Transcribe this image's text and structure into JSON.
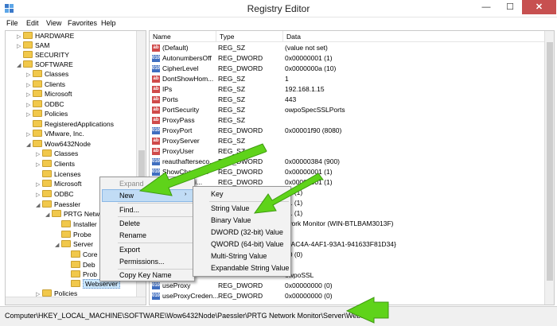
{
  "window": {
    "title": "Registry Editor",
    "minimize": "—",
    "maximize": "☐",
    "close": "✕"
  },
  "menubar": [
    "File",
    "Edit",
    "View",
    "Favorites",
    "Help"
  ],
  "tree": [
    {
      "label": "HARDWARE"
    },
    {
      "label": "SAM"
    },
    {
      "label": "SECURITY"
    },
    {
      "label": "SOFTWARE"
    },
    {
      "label": "Classes"
    },
    {
      "label": "Clients"
    },
    {
      "label": "Microsoft"
    },
    {
      "label": "ODBC"
    },
    {
      "label": "Policies"
    },
    {
      "label": "RegisteredApplications"
    },
    {
      "label": "VMware, Inc."
    },
    {
      "label": "Wow6432Node"
    },
    {
      "label": "Classes"
    },
    {
      "label": "Clients"
    },
    {
      "label": "Licenses"
    },
    {
      "label": "Microsoft"
    },
    {
      "label": "ODBC"
    },
    {
      "label": "Paessler"
    },
    {
      "label": "PRTG Netw"
    },
    {
      "label": "Installer"
    },
    {
      "label": "Probe"
    },
    {
      "label": "Server"
    },
    {
      "label": "Core"
    },
    {
      "label": "Deb"
    },
    {
      "label": "Prob"
    },
    {
      "label": "Webserver"
    },
    {
      "label": "Policies"
    }
  ],
  "list": {
    "columns": [
      "Name",
      "Type",
      "Data"
    ],
    "rows": [
      {
        "icon": "ab",
        "name": "(Default)",
        "type": "REG_SZ",
        "data": "(value not set)"
      },
      {
        "icon": "010",
        "name": "AutonumbersOff",
        "type": "REG_DWORD",
        "data": "0x00000001 (1)"
      },
      {
        "icon": "010",
        "name": "CipherLevel",
        "type": "REG_DWORD",
        "data": "0x0000000a (10)"
      },
      {
        "icon": "ab",
        "name": "DontShowHom...",
        "type": "REG_SZ",
        "data": "1"
      },
      {
        "icon": "ab",
        "name": "IPs",
        "type": "REG_SZ",
        "data": "192.168.1.15"
      },
      {
        "icon": "ab",
        "name": "Ports",
        "type": "REG_SZ",
        "data": "443"
      },
      {
        "icon": "ab",
        "name": "PortSecurity",
        "type": "REG_SZ",
        "data": "owpoSpecSSLPorts"
      },
      {
        "icon": "ab",
        "name": "ProxyPass",
        "type": "REG_SZ",
        "data": ""
      },
      {
        "icon": "010",
        "name": "ProxyPort",
        "type": "REG_DWORD",
        "data": "0x00001f90 (8080)"
      },
      {
        "icon": "ab",
        "name": "ProxyServer",
        "type": "REG_SZ",
        "data": ""
      },
      {
        "icon": "ab",
        "name": "ProxyUser",
        "type": "REG_SZ",
        "data": ""
      },
      {
        "icon": "010",
        "name": "reauthafterseco...",
        "type": "REG_DWORD",
        "data": "0x00000384 (900)"
      },
      {
        "icon": "010",
        "name": "ShowChange...",
        "type": "REG_DWORD",
        "data": "0x00000001 (1)"
      },
      {
        "icon": "010",
        "name": "ShowLockli...",
        "type": "REG_DWORD",
        "data": "0x00000001 (1)"
      },
      {
        "icon": "ab",
        "name": "",
        "type": "",
        "data": "01 (1)"
      },
      {
        "icon": "ab",
        "name": "",
        "type": "",
        "data": "01 (1)"
      },
      {
        "icon": "ab",
        "name": "",
        "type": "",
        "data": "01 (1)"
      },
      {
        "icon": "ab",
        "name": "",
        "type": "",
        "data": "twork Monitor (WIN-BTLBAM3013F)"
      },
      {
        "icon": "ab",
        "name": "",
        "type": "",
        "data": ""
      },
      {
        "icon": "ab",
        "name": "",
        "type": "",
        "data": "1-AC4A-4AF1-93A1-941633F81D34}"
      },
      {
        "icon": "ab",
        "name": "",
        "type": "",
        "data": "00 (0)"
      },
      {
        "icon": "ab",
        "name": "",
        "type": "",
        "data": "s"
      },
      {
        "icon": "ab",
        "name": "",
        "type": "",
        "data": "owpoSSL"
      },
      {
        "icon": "010",
        "name": "useProxy",
        "type": "REG_DWORD",
        "data": "0x00000000 (0)"
      },
      {
        "icon": "010",
        "name": "useProxyCreden...",
        "type": "REG_DWORD",
        "data": "0x00000000 (0)"
      }
    ]
  },
  "context_menu": {
    "items": [
      "Expand",
      "New",
      "Find...",
      "Delete",
      "Rename",
      "Export",
      "Permissions...",
      "Copy Key Name"
    ],
    "submenu_arrow": "›"
  },
  "new_submenu": {
    "items": [
      "Key",
      "String Value",
      "Binary Value",
      "DWORD (32-bit) Value",
      "QWORD (64-bit) Value",
      "Multi-String Value",
      "Expandable String Value"
    ]
  },
  "status_bar": {
    "path": "Computer\\HKEY_LOCAL_MACHINE\\SOFTWARE\\Wow6432Node\\Paessler\\PRTG Network Monitor\\Server\\Webserver"
  },
  "colors": {
    "arrow": "#5fd31a",
    "selection": "#c1dcf5",
    "folder": "#f1c84b",
    "close_button": "#c75050"
  }
}
